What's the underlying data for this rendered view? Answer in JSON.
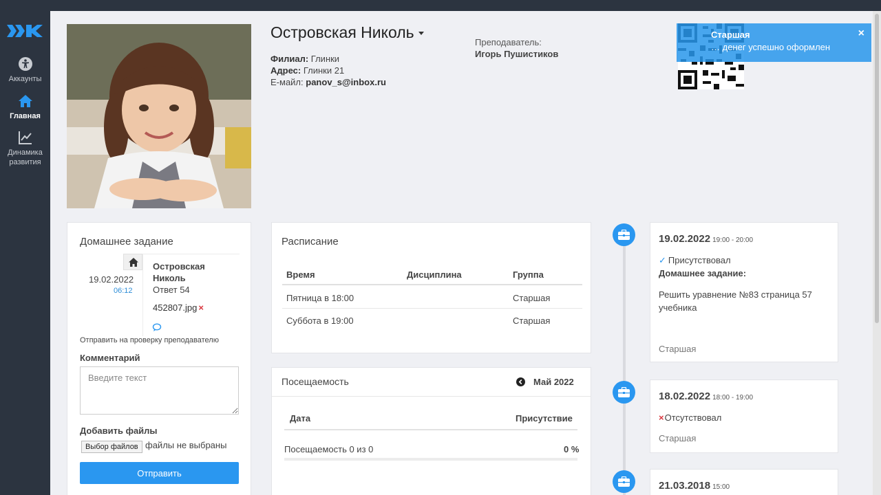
{
  "sidebar": {
    "items": [
      {
        "label": "Аккаунты",
        "icon": "accessibility-icon",
        "active": false
      },
      {
        "label": "Главная",
        "icon": "home-icon",
        "active": true
      },
      {
        "label": "Динамика развития",
        "icon": "chart-line-icon",
        "active": false
      }
    ]
  },
  "profile": {
    "name": "Островская Николь",
    "branch_label": "Филиал:",
    "branch_value": "Глинки",
    "address_label": "Адрес:",
    "address_value": "Глинки 21",
    "email_label": "E-майл:",
    "email_value": "panov_s@inbox.ru",
    "teacher_label": "Преподаватель:",
    "teacher_value": "Игорь Пушистиков"
  },
  "toast": {
    "title": "Старшая",
    "message": "… денег успешно оформлен"
  },
  "homework": {
    "title": "Домашнее задание",
    "date": "19.02.2022",
    "time": "06:12",
    "student": "Островская Николь",
    "answer": "Ответ 54",
    "file": "452807.jpg",
    "send_review": "Отправить на проверку преподавателю",
    "comment_label": "Комментарий",
    "comment_placeholder": "Введите текст",
    "files_label": "Добавить файлы",
    "file_button": "Выбор файлов",
    "file_none": "файлы не выбраны",
    "submit": "Отправить"
  },
  "schedule": {
    "title": "Расписание",
    "headers": [
      "Время",
      "Дисциплина",
      "Группа"
    ],
    "rows": [
      [
        "Пятница в 18:00",
        "",
        "Старшая"
      ],
      [
        "Суббота в 19:00",
        "",
        "Старшая"
      ]
    ]
  },
  "attendance": {
    "title": "Посещаемость",
    "month": "Май 2022",
    "col_date": "Дата",
    "col_presence": "Присутствие",
    "summary": "Посещаемость 0 из 0",
    "percent": "0 %"
  },
  "timeline": [
    {
      "date": "19.02.2022",
      "time": "19:00 - 20:00",
      "status": "Присутствовал",
      "status_type": "present",
      "homework_label": "Домашнее задание:",
      "homework_text": "Решить уравнение №83 страница 57 учебника",
      "group": "Старшая"
    },
    {
      "date": "18.02.2022",
      "time": "18:00 - 19:00",
      "status": "Отсутствовал",
      "status_type": "absent",
      "group": "Старшая"
    },
    {
      "date": "21.03.2018",
      "time": "15:00"
    }
  ],
  "colors": {
    "accent": "#2a97f0",
    "sidebar": "#2c3440",
    "background": "#eff0f4",
    "danger": "#d9363e"
  }
}
